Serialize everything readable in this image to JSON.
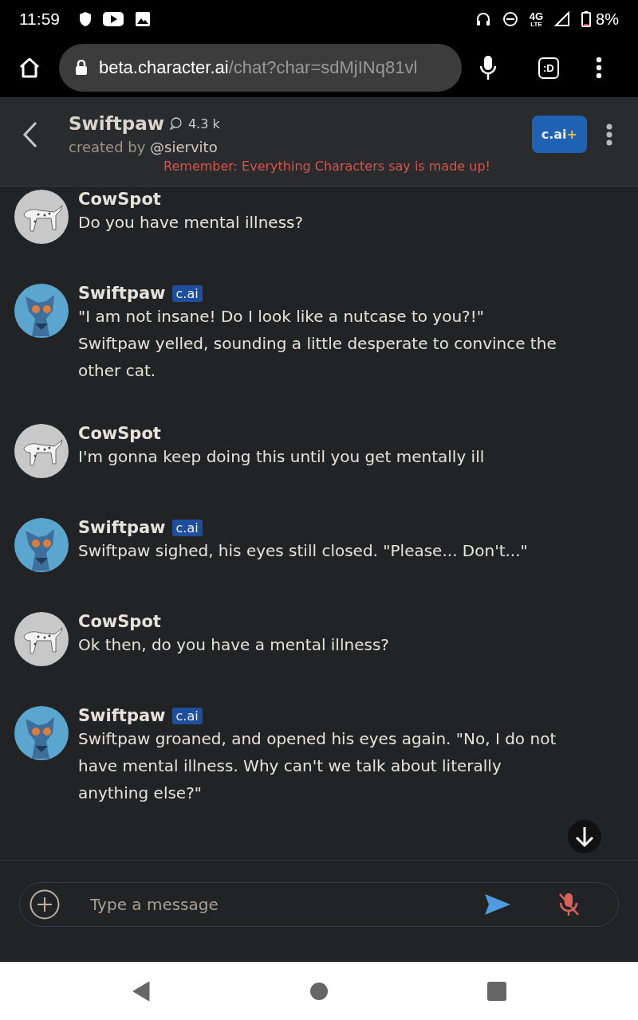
{
  "status_bar": {
    "time": "11:59",
    "network": "4G",
    "network_sub": "LTE",
    "battery": "8%"
  },
  "browser": {
    "url_host": "beta.character.ai",
    "url_path": "/chat?char=sdMjINq81vl",
    "tab_label": ":D"
  },
  "header": {
    "name": "Swiftpaw",
    "chat_count": "4.3 k",
    "created_by": "created by",
    "creator": "@siervito",
    "plus_button": "c.ai",
    "plus_mark": "+",
    "notice": "Remember: Everything Characters say is made up!"
  },
  "messages": [
    {
      "kind": "user",
      "name": "CowSpot",
      "text": "Do you have mental illness?"
    },
    {
      "kind": "character",
      "name": "Swiftpaw",
      "badge": "c.ai",
      "text": "\"I am not insane! Do I look like a nutcase to you?!\" Swiftpaw yelled, sounding a little desperate to convince the other cat."
    },
    {
      "kind": "user",
      "name": "CowSpot",
      "text": "I'm gonna keep doing this until you get mentally ill"
    },
    {
      "kind": "character",
      "name": "Swiftpaw",
      "badge": "c.ai",
      "text": "Swiftpaw sighed, his eyes still closed. \"Please... Don't...\""
    },
    {
      "kind": "user",
      "name": "CowSpot",
      "text": "Ok then, do you have a mental illness?"
    },
    {
      "kind": "character",
      "name": "Swiftpaw",
      "badge": "c.ai",
      "text": "Swiftpaw groaned, and opened his eyes again. \"No, I do not have mental illness. Why can't we talk about literally anything else?\""
    }
  ],
  "composer": {
    "placeholder": "Type a message",
    "mic_muted": true
  }
}
